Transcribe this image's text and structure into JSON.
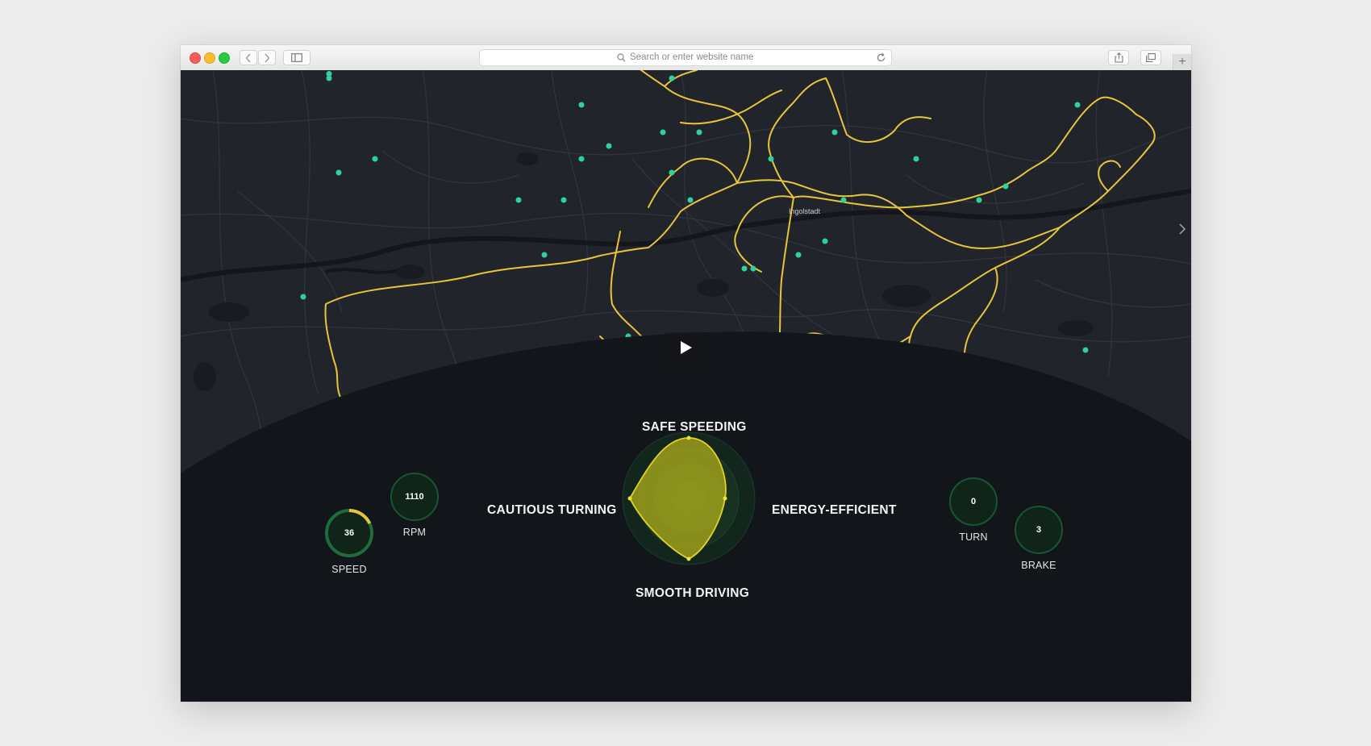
{
  "browser": {
    "address_placeholder": "Search or enter website name",
    "new_tab_label": "+"
  },
  "map": {
    "city_label": "Ingolstadt",
    "route_color": "#e7c53a",
    "marker_color": "#2fd29a",
    "background_color": "#23252e"
  },
  "video": {
    "play_icon": "play-icon"
  },
  "metrics": {
    "speed": {
      "value": "36",
      "label": "SPEED",
      "fraction": 0.18
    },
    "rpm": {
      "value": "1110",
      "label": "RPM"
    },
    "turn": {
      "value": "0",
      "label": "TURN"
    },
    "brake": {
      "value": "3",
      "label": "BRAKE"
    }
  },
  "radar": {
    "top": "SAFE SPEEDING",
    "bottom": "SMOOTH DRIVING",
    "left": "CAUTIOUS TURNING",
    "right": "ENERGY-EFFICIENT",
    "fill_color": "#b6b21a"
  },
  "colors": {
    "accent_yellow": "#e7c53a",
    "gauge_ring": "#1f6b3e",
    "panel_bg": "#121519"
  }
}
